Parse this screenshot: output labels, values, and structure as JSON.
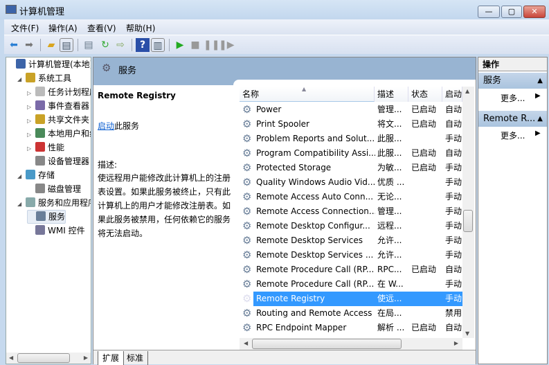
{
  "window": {
    "title": "计算机管理",
    "minimize": "—",
    "maximize": "▢",
    "close": "✕",
    "close_color": "#c9453a"
  },
  "menu": [
    "文件(F)",
    "操作(A)",
    "查看(V)",
    "帮助(H)"
  ],
  "toolbar": {
    "icons": [
      "back-icon",
      "forward-icon",
      "up-folder-icon",
      "show-tree-icon",
      "properties-icon",
      "refresh-icon",
      "export-icon",
      "help-icon",
      "action-pane-icon",
      "start-icon",
      "stop-icon",
      "pause-icon",
      "resume-icon"
    ]
  },
  "tree": [
    {
      "label": "计算机管理(本地)",
      "level": 0,
      "exp": ""
    },
    {
      "label": "系统工具",
      "level": 1,
      "exp": "◢"
    },
    {
      "label": "任务计划程序",
      "level": 2,
      "exp": "▷"
    },
    {
      "label": "事件查看器",
      "level": 2,
      "exp": "▷"
    },
    {
      "label": "共享文件夹",
      "level": 2,
      "exp": "▷"
    },
    {
      "label": "本地用户和组",
      "level": 2,
      "exp": "▷"
    },
    {
      "label": "性能",
      "level": 2,
      "exp": "▷"
    },
    {
      "label": "设备管理器",
      "level": 2,
      "exp": ""
    },
    {
      "label": "存储",
      "level": 1,
      "exp": "◢"
    },
    {
      "label": "磁盘管理",
      "level": 2,
      "exp": ""
    },
    {
      "label": "服务和应用程序",
      "level": 1,
      "exp": "◢"
    },
    {
      "label": "服务",
      "level": 2,
      "exp": "",
      "selected": true
    },
    {
      "label": "WMI 控件",
      "level": 2,
      "exp": ""
    }
  ],
  "main": {
    "header": "服务",
    "detail": {
      "name": "Remote Registry",
      "start_link": "启动",
      "start_suffix": "此服务",
      "desc_label": "描述:",
      "desc": "使远程用户能修改此计算机上的注册表设置。如果此服务被终止，只有此计算机上的用户才能修改注册表。如果此服务被禁用，任何依赖它的服务将无法启动。"
    },
    "columns": [
      "名称",
      "描述",
      "状态",
      "启动"
    ],
    "rows": [
      [
        "Power",
        "管理...",
        "已启动",
        "自动"
      ],
      [
        "Print Spooler",
        "将文...",
        "已启动",
        "自动"
      ],
      [
        "Problem Reports and Solut...",
        "此服...",
        "",
        "手动"
      ],
      [
        "Program Compatibility Assi...",
        "此服...",
        "已启动",
        "自动"
      ],
      [
        "Protected Storage",
        "为敏...",
        "已启动",
        "手动"
      ],
      [
        "Quality Windows Audio Vid...",
        "优质 ...",
        "",
        "手动"
      ],
      [
        "Remote Access Auto Conn...",
        "无论...",
        "",
        "手动"
      ],
      [
        "Remote Access Connection...",
        "管理...",
        "",
        "手动"
      ],
      [
        "Remote Desktop Configur...",
        "远程...",
        "",
        "手动"
      ],
      [
        "Remote Desktop Services",
        "允许...",
        "",
        "手动"
      ],
      [
        "Remote Desktop Services ...",
        "允许...",
        "",
        "手动"
      ],
      [
        "Remote Procedure Call (RP...",
        "RPC...",
        "已启动",
        "自动"
      ],
      [
        "Remote Procedure Call (RP...",
        "在 W...",
        "",
        "手动"
      ],
      [
        "Remote Registry",
        "使远...",
        "",
        "手动"
      ],
      [
        "Routing and Remote Access",
        "在局...",
        "",
        "禁用"
      ],
      [
        "RPC Endpoint Mapper",
        "解析 ...",
        "已启动",
        "自动"
      ]
    ],
    "selected_index": 13,
    "tabs": [
      "扩展",
      "标准"
    ]
  },
  "actions": {
    "title": "操作",
    "sections": [
      {
        "label": "服务",
        "more": "更多..."
      },
      {
        "label": "Remote R...",
        "more": "更多..."
      }
    ]
  }
}
